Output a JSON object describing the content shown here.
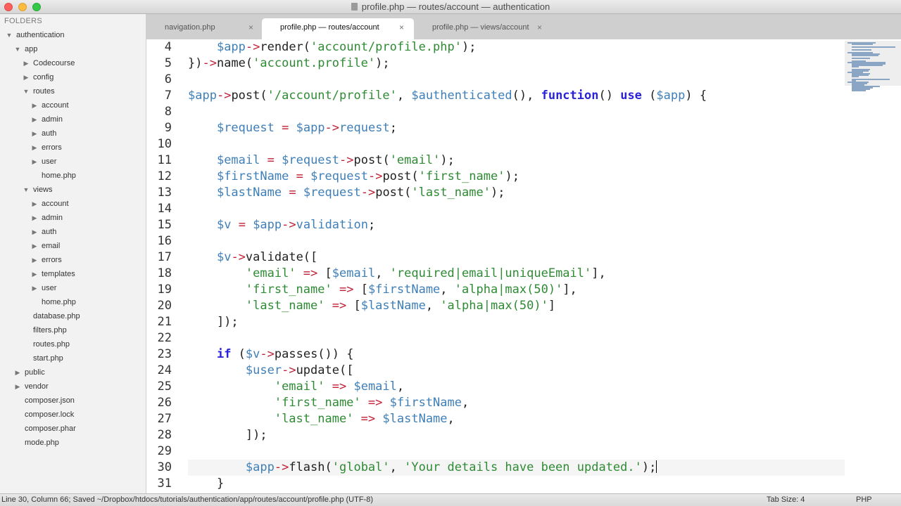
{
  "window": {
    "title": "profile.php — routes/account — authentication"
  },
  "sidebar": {
    "header": "FOLDERS",
    "tree": [
      {
        "label": "authentication",
        "depth": 0,
        "type": "folder",
        "expanded": true
      },
      {
        "label": "app",
        "depth": 1,
        "type": "folder",
        "expanded": true
      },
      {
        "label": "Codecourse",
        "depth": 2,
        "type": "folder",
        "expanded": false
      },
      {
        "label": "config",
        "depth": 2,
        "type": "folder",
        "expanded": false
      },
      {
        "label": "routes",
        "depth": 2,
        "type": "folder",
        "expanded": true
      },
      {
        "label": "account",
        "depth": 3,
        "type": "folder",
        "expanded": false
      },
      {
        "label": "admin",
        "depth": 3,
        "type": "folder",
        "expanded": false
      },
      {
        "label": "auth",
        "depth": 3,
        "type": "folder",
        "expanded": false
      },
      {
        "label": "errors",
        "depth": 3,
        "type": "folder",
        "expanded": false
      },
      {
        "label": "user",
        "depth": 3,
        "type": "folder",
        "expanded": false
      },
      {
        "label": "home.php",
        "depth": 3,
        "type": "file"
      },
      {
        "label": "views",
        "depth": 2,
        "type": "folder",
        "expanded": true
      },
      {
        "label": "account",
        "depth": 3,
        "type": "folder",
        "expanded": false
      },
      {
        "label": "admin",
        "depth": 3,
        "type": "folder",
        "expanded": false
      },
      {
        "label": "auth",
        "depth": 3,
        "type": "folder",
        "expanded": false
      },
      {
        "label": "email",
        "depth": 3,
        "type": "folder",
        "expanded": false
      },
      {
        "label": "errors",
        "depth": 3,
        "type": "folder",
        "expanded": false
      },
      {
        "label": "templates",
        "depth": 3,
        "type": "folder",
        "expanded": false
      },
      {
        "label": "user",
        "depth": 3,
        "type": "folder",
        "expanded": false
      },
      {
        "label": "home.php",
        "depth": 3,
        "type": "file"
      },
      {
        "label": "database.php",
        "depth": 2,
        "type": "file"
      },
      {
        "label": "filters.php",
        "depth": 2,
        "type": "file"
      },
      {
        "label": "routes.php",
        "depth": 2,
        "type": "file"
      },
      {
        "label": "start.php",
        "depth": 2,
        "type": "file"
      },
      {
        "label": "public",
        "depth": 1,
        "type": "folder",
        "expanded": false
      },
      {
        "label": "vendor",
        "depth": 1,
        "type": "folder",
        "expanded": false
      },
      {
        "label": "composer.json",
        "depth": 1,
        "type": "file"
      },
      {
        "label": "composer.lock",
        "depth": 1,
        "type": "file"
      },
      {
        "label": "composer.phar",
        "depth": 1,
        "type": "file"
      },
      {
        "label": "mode.php",
        "depth": 1,
        "type": "file"
      }
    ]
  },
  "tabs": [
    {
      "label": "navigation.php",
      "active": false
    },
    {
      "label": "profile.php — routes/account",
      "active": true
    },
    {
      "label": "profile.php — views/account",
      "active": false
    }
  ],
  "tab_close_glyph": "×",
  "editor": {
    "current_line": 30,
    "lines": [
      {
        "n": "4",
        "tokens": [
          [
            "p",
            "    "
          ],
          [
            "var",
            "$app"
          ],
          [
            "op",
            "->"
          ],
          [
            "fn",
            "render("
          ],
          [
            "str",
            "'account/profile.php'"
          ],
          [
            "p",
            ");"
          ]
        ]
      },
      {
        "n": "5",
        "tokens": [
          [
            "p",
            "})"
          ],
          [
            "op",
            "->"
          ],
          [
            "fn",
            "name("
          ],
          [
            "str",
            "'account.profile'"
          ],
          [
            "p",
            ");"
          ]
        ]
      },
      {
        "n": "6",
        "tokens": []
      },
      {
        "n": "7",
        "tokens": [
          [
            "var",
            "$app"
          ],
          [
            "op",
            "->"
          ],
          [
            "fn",
            "post("
          ],
          [
            "str",
            "'/account/profile'"
          ],
          [
            "p",
            ", "
          ],
          [
            "var",
            "$authenticated"
          ],
          [
            "p",
            "(), "
          ],
          [
            "kw",
            "function"
          ],
          [
            "p",
            "() "
          ],
          [
            "kw",
            "use"
          ],
          [
            "p",
            " ("
          ],
          [
            "var",
            "$app"
          ],
          [
            "p",
            ") {"
          ]
        ]
      },
      {
        "n": "8",
        "tokens": []
      },
      {
        "n": "9",
        "tokens": [
          [
            "p",
            "    "
          ],
          [
            "var",
            "$request"
          ],
          [
            "p",
            " "
          ],
          [
            "op",
            "="
          ],
          [
            "p",
            " "
          ],
          [
            "var",
            "$app"
          ],
          [
            "op",
            "->"
          ],
          [
            "var",
            "request"
          ],
          [
            "p",
            ";"
          ]
        ]
      },
      {
        "n": "10",
        "tokens": []
      },
      {
        "n": "11",
        "tokens": [
          [
            "p",
            "    "
          ],
          [
            "var",
            "$email"
          ],
          [
            "p",
            " "
          ],
          [
            "op",
            "="
          ],
          [
            "p",
            " "
          ],
          [
            "var",
            "$request"
          ],
          [
            "op",
            "->"
          ],
          [
            "fn",
            "post("
          ],
          [
            "str",
            "'email'"
          ],
          [
            "p",
            ");"
          ]
        ]
      },
      {
        "n": "12",
        "tokens": [
          [
            "p",
            "    "
          ],
          [
            "var",
            "$firstName"
          ],
          [
            "p",
            " "
          ],
          [
            "op",
            "="
          ],
          [
            "p",
            " "
          ],
          [
            "var",
            "$request"
          ],
          [
            "op",
            "->"
          ],
          [
            "fn",
            "post("
          ],
          [
            "str",
            "'first_name'"
          ],
          [
            "p",
            ");"
          ]
        ]
      },
      {
        "n": "13",
        "tokens": [
          [
            "p",
            "    "
          ],
          [
            "var",
            "$lastName"
          ],
          [
            "p",
            " "
          ],
          [
            "op",
            "="
          ],
          [
            "p",
            " "
          ],
          [
            "var",
            "$request"
          ],
          [
            "op",
            "->"
          ],
          [
            "fn",
            "post("
          ],
          [
            "str",
            "'last_name'"
          ],
          [
            "p",
            ");"
          ]
        ]
      },
      {
        "n": "14",
        "tokens": []
      },
      {
        "n": "15",
        "tokens": [
          [
            "p",
            "    "
          ],
          [
            "var",
            "$v"
          ],
          [
            "p",
            " "
          ],
          [
            "op",
            "="
          ],
          [
            "p",
            " "
          ],
          [
            "var",
            "$app"
          ],
          [
            "op",
            "->"
          ],
          [
            "var",
            "validation"
          ],
          [
            "p",
            ";"
          ]
        ]
      },
      {
        "n": "16",
        "tokens": []
      },
      {
        "n": "17",
        "tokens": [
          [
            "p",
            "    "
          ],
          [
            "var",
            "$v"
          ],
          [
            "op",
            "->"
          ],
          [
            "fn",
            "validate(["
          ]
        ]
      },
      {
        "n": "18",
        "tokens": [
          [
            "p",
            "        "
          ],
          [
            "str",
            "'email'"
          ],
          [
            "p",
            " "
          ],
          [
            "op",
            "=>"
          ],
          [
            "p",
            " ["
          ],
          [
            "var",
            "$email"
          ],
          [
            "p",
            ", "
          ],
          [
            "str",
            "'required|email|uniqueEmail'"
          ],
          [
            "p",
            "],"
          ]
        ]
      },
      {
        "n": "19",
        "tokens": [
          [
            "p",
            "        "
          ],
          [
            "str",
            "'first_name'"
          ],
          [
            "p",
            " "
          ],
          [
            "op",
            "=>"
          ],
          [
            "p",
            " ["
          ],
          [
            "var",
            "$firstName"
          ],
          [
            "p",
            ", "
          ],
          [
            "str",
            "'alpha|max(50)'"
          ],
          [
            "p",
            "],"
          ]
        ]
      },
      {
        "n": "20",
        "tokens": [
          [
            "p",
            "        "
          ],
          [
            "str",
            "'last_name'"
          ],
          [
            "p",
            " "
          ],
          [
            "op",
            "=>"
          ],
          [
            "p",
            " ["
          ],
          [
            "var",
            "$lastName"
          ],
          [
            "p",
            ", "
          ],
          [
            "str",
            "'alpha|max(50)'"
          ],
          [
            "p",
            "]"
          ]
        ]
      },
      {
        "n": "21",
        "tokens": [
          [
            "p",
            "    ]);"
          ]
        ]
      },
      {
        "n": "22",
        "tokens": []
      },
      {
        "n": "23",
        "tokens": [
          [
            "p",
            "    "
          ],
          [
            "kw",
            "if"
          ],
          [
            "p",
            " ("
          ],
          [
            "var",
            "$v"
          ],
          [
            "op",
            "->"
          ],
          [
            "fn",
            "passes()) {"
          ]
        ]
      },
      {
        "n": "24",
        "tokens": [
          [
            "p",
            "        "
          ],
          [
            "var",
            "$user"
          ],
          [
            "op",
            "->"
          ],
          [
            "fn",
            "update(["
          ]
        ]
      },
      {
        "n": "25",
        "tokens": [
          [
            "p",
            "            "
          ],
          [
            "str",
            "'email'"
          ],
          [
            "p",
            " "
          ],
          [
            "op",
            "=>"
          ],
          [
            "p",
            " "
          ],
          [
            "var",
            "$email"
          ],
          [
            "p",
            ","
          ]
        ]
      },
      {
        "n": "26",
        "tokens": [
          [
            "p",
            "            "
          ],
          [
            "str",
            "'first_name'"
          ],
          [
            "p",
            " "
          ],
          [
            "op",
            "=>"
          ],
          [
            "p",
            " "
          ],
          [
            "var",
            "$firstName"
          ],
          [
            "p",
            ","
          ]
        ]
      },
      {
        "n": "27",
        "tokens": [
          [
            "p",
            "            "
          ],
          [
            "str",
            "'last_name'"
          ],
          [
            "p",
            " "
          ],
          [
            "op",
            "=>"
          ],
          [
            "p",
            " "
          ],
          [
            "var",
            "$lastName"
          ],
          [
            "p",
            ","
          ]
        ]
      },
      {
        "n": "28",
        "tokens": [
          [
            "p",
            "        ]);"
          ]
        ]
      },
      {
        "n": "29",
        "tokens": []
      },
      {
        "n": "30",
        "tokens": [
          [
            "p",
            "        "
          ],
          [
            "var",
            "$app"
          ],
          [
            "op",
            "->"
          ],
          [
            "fn",
            "flash("
          ],
          [
            "str",
            "'global'"
          ],
          [
            "p",
            ", "
          ],
          [
            "str",
            "'Your details have been updated.'"
          ],
          [
            "p",
            ");"
          ]
        ]
      },
      {
        "n": "31",
        "tokens": [
          [
            "p",
            "    }"
          ]
        ]
      }
    ]
  },
  "status": {
    "left": "Line 30, Column 66; Saved ~/Dropbox/htdocs/tutorials/authentication/app/routes/account/profile.php (UTF-8)",
    "tab_size": "Tab Size: 4",
    "language": "PHP"
  },
  "colors": {
    "variable": "#3f7fb8",
    "string": "#2e8b34",
    "operator": "#c01f34",
    "keyword": "#2b23d8"
  },
  "icons": {
    "expanded": "▼",
    "collapsed": "▶",
    "file": "file-icon"
  }
}
